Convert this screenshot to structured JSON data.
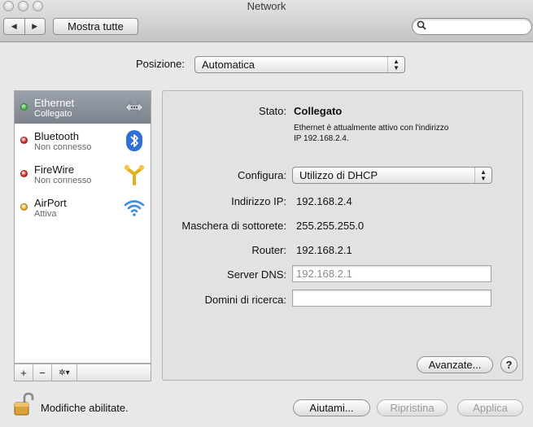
{
  "window": {
    "title": "Network"
  },
  "toolbar": {
    "back_icon": "back-arrow-icon",
    "forward_icon": "forward-arrow-icon",
    "show_all_label": "Mostra tutte",
    "search_placeholder": ""
  },
  "location": {
    "label": "Posizione:",
    "value": "Automatica"
  },
  "services": [
    {
      "name": "Ethernet",
      "status": "Collegato",
      "status_color": "#3fbf3f",
      "icon": "ethernet-icon",
      "selected": true
    },
    {
      "name": "Bluetooth",
      "status": "Non connesso",
      "status_color": "#d81e1e",
      "icon": "bluetooth-icon",
      "selected": false
    },
    {
      "name": "FireWire",
      "status": "Non connesso",
      "status_color": "#d81e1e",
      "icon": "firewire-icon",
      "selected": false
    },
    {
      "name": "AirPort",
      "status": "Attiva",
      "status_color": "#f2a81a",
      "icon": "airport-wifi-icon",
      "selected": false
    }
  ],
  "sidebar_controls": {
    "add": "+",
    "remove": "−",
    "gear": "✲▾"
  },
  "detail": {
    "status_label": "Stato:",
    "status_value": "Collegato",
    "status_desc_line1": "Ethernet è attualmente attivo con l'indirizzo",
    "status_desc_line2": "IP 192.168.2.4.",
    "configure_label": "Configura:",
    "configure_value": "Utilizzo di DHCP",
    "ip_label": "Indirizzo IP:",
    "ip_value": "192.168.2.4",
    "mask_label": "Maschera di sottorete:",
    "mask_value": "255.255.255.0",
    "router_label": "Router:",
    "router_value": "192.168.2.1",
    "dns_label": "Server DNS:",
    "dns_value": "192.168.2.1",
    "search_domains_label": "Domini di ricerca:",
    "search_domains_value": "",
    "advanced_label": "Avanzate...",
    "help_label": "?"
  },
  "footer": {
    "lock_text": "Modifiche abilitate.",
    "assist_label": "Aiutami...",
    "revert_label": "Ripristina",
    "apply_label": "Applica"
  },
  "colors": {
    "selection": "#8a9099",
    "window_bg": "#e8e8e8",
    "panel_bg": "#e2e2e2"
  }
}
